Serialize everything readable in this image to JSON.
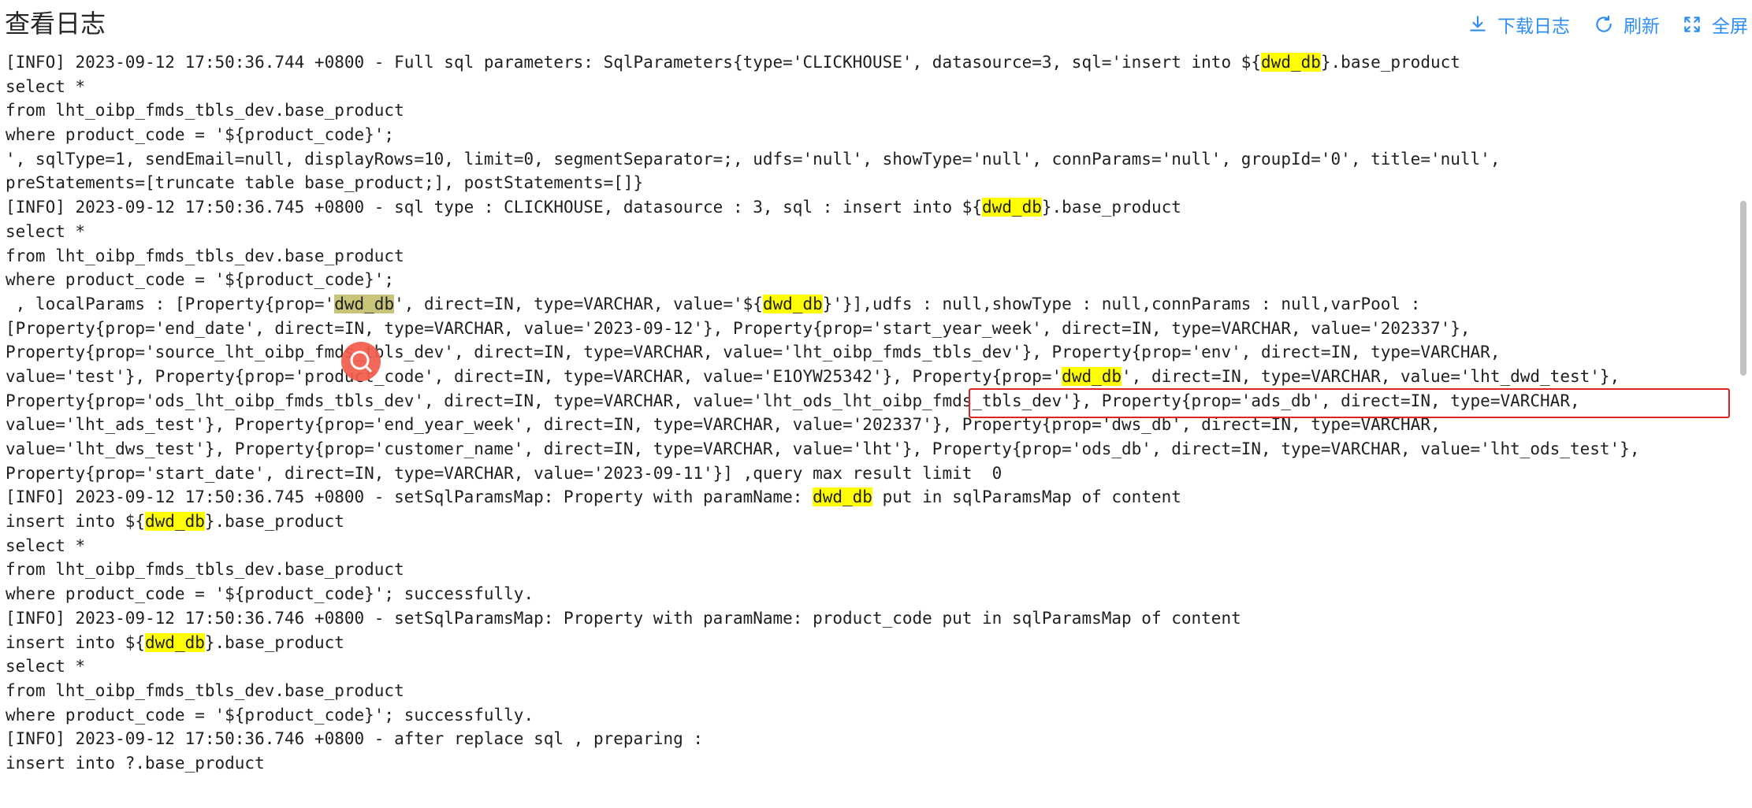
{
  "header": {
    "title": "查看日志",
    "download_label": "下载日志",
    "refresh_label": "刷新",
    "fullscreen_label": "全屏"
  },
  "icons": {
    "download": "download-icon",
    "refresh": "refresh-icon",
    "fullscreen": "fullscreen-icon",
    "search": "search-icon"
  },
  "colors": {
    "accent": "#2f8ef4",
    "highlight": "#ffff00",
    "annotation_box": "#e02424",
    "floating_button": "#f45c4c"
  },
  "log": {
    "lines": [
      [
        {
          "t": "[INFO] 2023-09-12 17:50:36.744 +0800 - Full sql parameters: SqlParameters{type='CLICKHOUSE', datasource=3, sql='insert into ${"
        },
        {
          "t": "dwd_db",
          "h": 1
        },
        {
          "t": "}.base_product"
        }
      ],
      [
        {
          "t": "select *"
        }
      ],
      [
        {
          "t": "from lht_oibp_fmds_tbls_dev.base_product"
        }
      ],
      [
        {
          "t": "where product_code = '${product_code}';"
        }
      ],
      [
        {
          "t": "', sqlType=1, sendEmail=null, displayRows=10, limit=0, segmentSeparator=;, udfs='null', showType='null', connParams='null', groupId='0', title='null',"
        }
      ],
      [
        {
          "t": "preStatements=[truncate table base_product;], postStatements=[]}"
        }
      ],
      [
        {
          "t": "[INFO] 2023-09-12 17:50:36.745 +0800 - sql type : CLICKHOUSE, datasource : 3, sql : insert into ${"
        },
        {
          "t": "dwd_db",
          "h": 1
        },
        {
          "t": "}.base_product"
        }
      ],
      [
        {
          "t": "select *"
        }
      ],
      [
        {
          "t": "from lht_oibp_fmds_tbls_dev.base_product"
        }
      ],
      [
        {
          "t": "where product_code = '${product_code}';"
        }
      ],
      [
        {
          "t": " , localParams : [Property{prop='"
        },
        {
          "t": "dwd_db",
          "h": 2
        },
        {
          "t": "', direct=IN, type=VARCHAR, value='${"
        },
        {
          "t": "dwd_db",
          "h": 1
        },
        {
          "t": "}'}],udfs : null,showType : null,connParams : null,varPool :"
        }
      ],
      [
        {
          "t": "[Property{prop='end_date', direct=IN, type=VARCHAR, value='2023-09-12'}, Property{prop='start_year_week', direct=IN, type=VARCHAR, value='202337'},"
        }
      ],
      [
        {
          "t": "Property{prop='source_lht_oibp_fmds_tbls_dev', direct=IN, type=VARCHAR, value='lht_oibp_fmds_tbls_dev'}, Property{prop='env', direct=IN, type=VARCHAR,"
        }
      ],
      [
        {
          "t": "value='test'}, Property{prop='product_code', direct=IN, type=VARCHAR, value='E1OYW25342'}, Property{prop='"
        },
        {
          "t": "dwd_db",
          "h": 1
        },
        {
          "t": "', direct=IN, type=VARCHAR, value='lht_dwd_test'},"
        }
      ],
      [
        {
          "t": "Property{prop='ods_lht_oibp_fmds_tbls_dev', direct=IN, type=VARCHAR, value='lht_ods_lht_oibp_fmds_tbls_dev'}, Property{prop='ads_db', direct=IN, type=VARCHAR,"
        }
      ],
      [
        {
          "t": "value='lht_ads_test'}, Property{prop='end_year_week', direct=IN, type=VARCHAR, value='202337'}, Property{prop='dws_db', direct=IN, type=VARCHAR,"
        }
      ],
      [
        {
          "t": "value='lht_dws_test'}, Property{prop='customer_name', direct=IN, type=VARCHAR, value='lht'}, Property{prop='ods_db', direct=IN, type=VARCHAR, value='lht_ods_test'},"
        }
      ],
      [
        {
          "t": "Property{prop='start_date', direct=IN, type=VARCHAR, value='2023-09-11'}] ,query max result limit  0"
        }
      ],
      [
        {
          "t": "[INFO] 2023-09-12 17:50:36.745 +0800 - setSqlParamsMap: Property with paramName: "
        },
        {
          "t": "dwd_db",
          "h": 1
        },
        {
          "t": " put in sqlParamsMap of content"
        }
      ],
      [
        {
          "t": "insert into ${"
        },
        {
          "t": "dwd_db",
          "h": 1
        },
        {
          "t": "}.base_product"
        }
      ],
      [
        {
          "t": "select *"
        }
      ],
      [
        {
          "t": "from lht_oibp_fmds_tbls_dev.base_product"
        }
      ],
      [
        {
          "t": "where product_code = '${product_code}'; successfully."
        }
      ],
      [
        {
          "t": "[INFO] 2023-09-12 17:50:36.746 +0800 - setSqlParamsMap: Property with paramName: product_code put in sqlParamsMap of content"
        }
      ],
      [
        {
          "t": "insert into ${"
        },
        {
          "t": "dwd_db",
          "h": 1
        },
        {
          "t": "}.base_product"
        }
      ],
      [
        {
          "t": "select *"
        }
      ],
      [
        {
          "t": "from lht_oibp_fmds_tbls_dev.base_product"
        }
      ],
      [
        {
          "t": "where product_code = '${product_code}'; successfully."
        }
      ],
      [
        {
          "t": "[INFO] 2023-09-12 17:50:36.746 +0800 - after replace sql , preparing :"
        }
      ],
      [
        {
          "t": "insert into ?.base_product"
        }
      ]
    ]
  }
}
